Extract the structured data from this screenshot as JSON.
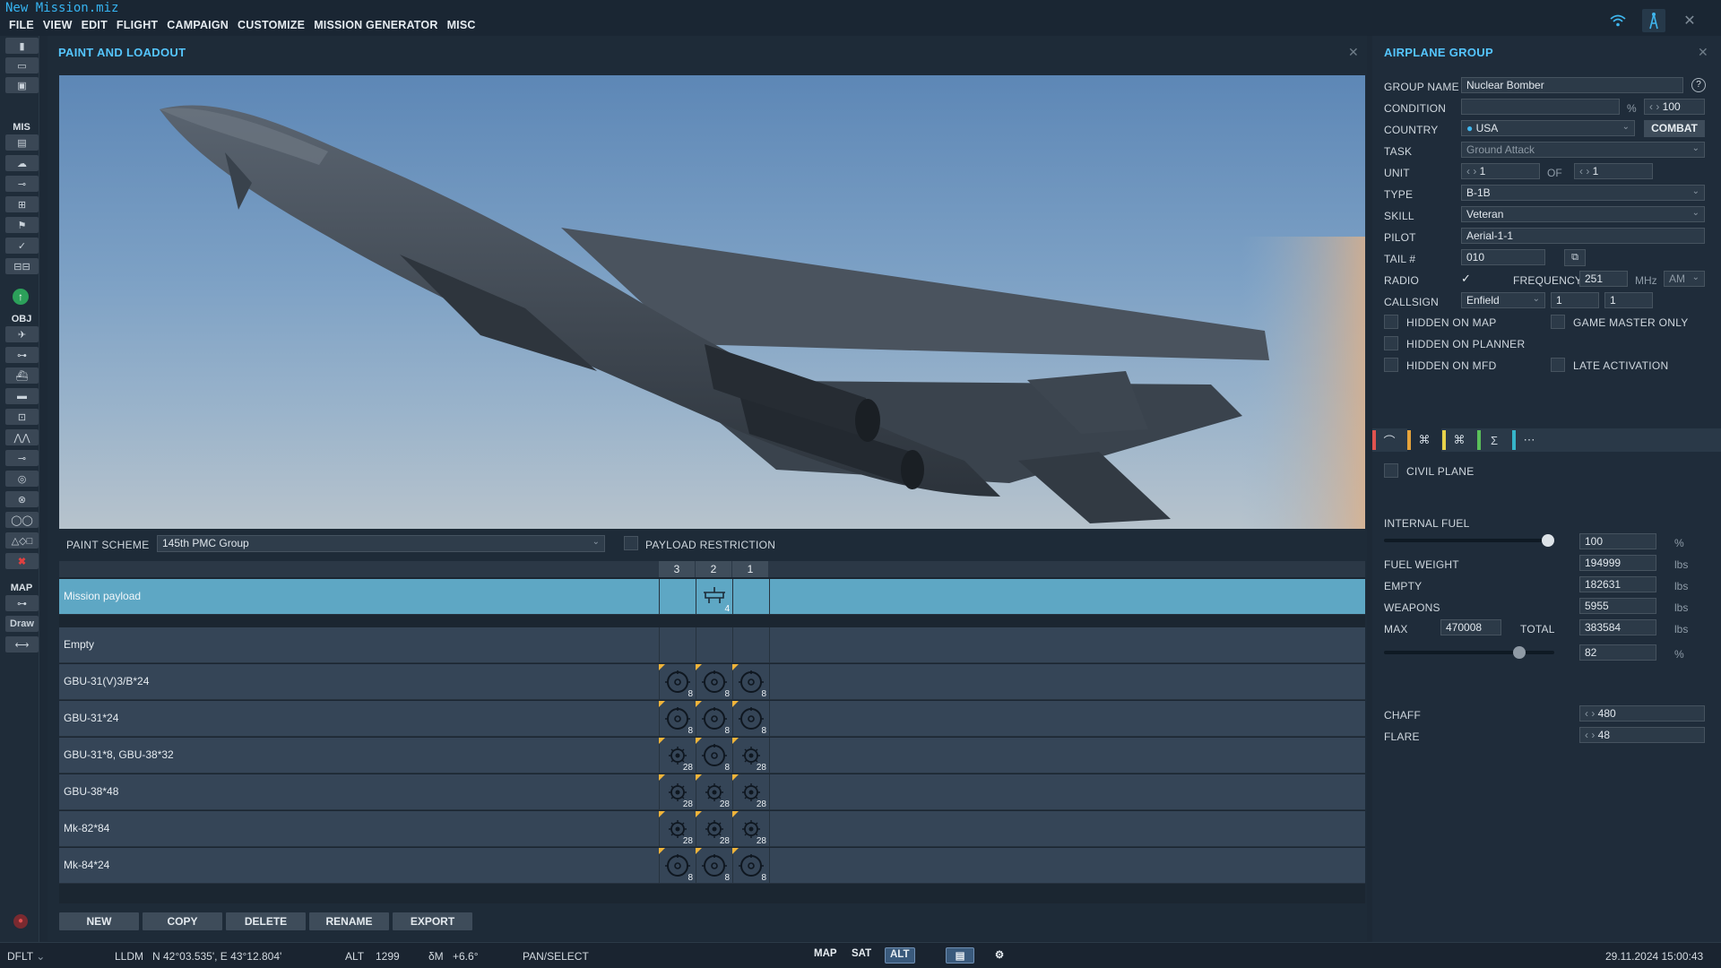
{
  "window": {
    "title": "New Mission.miz"
  },
  "menu": [
    "FILE",
    "VIEW",
    "EDIT",
    "FLIGHT",
    "CAMPAIGN",
    "CUSTOMIZE",
    "MISSION GENERATOR",
    "MISC"
  ],
  "toolbar": {
    "sections": {
      "mis": "MIS",
      "obj": "OBJ",
      "map": "MAP"
    },
    "draw_label": "Draw",
    "icons": [
      "new-icon",
      "open-icon",
      "save-icon",
      "briefing-icon",
      "weather-icon",
      "trigger-icon",
      "zone-icon",
      "flag-icon",
      "check-icon",
      "rules-icon",
      "helper-icon",
      "airplane-icon",
      "helicopter-icon",
      "ship-icon",
      "vehicle-icon",
      "static-icon",
      "template-icon",
      "nav-point-icon",
      "target-icon",
      "jammer-icon",
      "group-icon",
      "shapes-icon",
      "delete-icon",
      "ruler-icon"
    ]
  },
  "paint_loadout": {
    "title": "PAINT AND LOADOUT",
    "paint_scheme_label": "PAINT SCHEME",
    "paint_scheme_value": "145th PMC Group",
    "payload_restriction_label": "PAYLOAD RESTRICTION",
    "pylon_headers": [
      "3",
      "2",
      "1"
    ],
    "mission_payload": {
      "name": "Mission payload",
      "pylon2_count": "4"
    },
    "loadouts": [
      {
        "name": "Empty",
        "pylons": []
      },
      {
        "name": "GBU-31(V)3/B*24",
        "pylons": [
          {
            "icon": "large-bomb-icon",
            "count": "8"
          },
          {
            "icon": "large-bomb-icon",
            "count": "8"
          },
          {
            "icon": "large-bomb-icon",
            "count": "8"
          }
        ]
      },
      {
        "name": "GBU-31*24",
        "pylons": [
          {
            "icon": "large-bomb-icon",
            "count": "8"
          },
          {
            "icon": "large-bomb-icon",
            "count": "8"
          },
          {
            "icon": "large-bomb-icon",
            "count": "8"
          }
        ]
      },
      {
        "name": "GBU-31*8, GBU-38*32",
        "pylons": [
          {
            "icon": "small-bomb-icon",
            "count": "28"
          },
          {
            "icon": "large-bomb-icon",
            "count": "8"
          },
          {
            "icon": "small-bomb-icon",
            "count": "28"
          }
        ]
      },
      {
        "name": "GBU-38*48",
        "pylons": [
          {
            "icon": "small-bomb-icon",
            "count": "28"
          },
          {
            "icon": "small-bomb-icon",
            "count": "28"
          },
          {
            "icon": "small-bomb-icon",
            "count": "28"
          }
        ]
      },
      {
        "name": "Mk-82*84",
        "pylons": [
          {
            "icon": "small-bomb-icon",
            "count": "28"
          },
          {
            "icon": "small-bomb-icon",
            "count": "28"
          },
          {
            "icon": "small-bomb-icon",
            "count": "28"
          }
        ]
      },
      {
        "name": "Mk-84*24",
        "pylons": [
          {
            "icon": "large-bomb-icon",
            "count": "8"
          },
          {
            "icon": "large-bomb-icon",
            "count": "8"
          },
          {
            "icon": "large-bomb-icon",
            "count": "8"
          }
        ]
      }
    ],
    "buttons": {
      "new": "NEW",
      "copy": "COPY",
      "delete": "DELETE",
      "rename": "RENAME",
      "export": "EXPORT"
    }
  },
  "airplane_group": {
    "title": "AIRPLANE GROUP",
    "group_name_label": "GROUP NAME",
    "group_name": "Nuclear Bomber",
    "condition_label": "CONDITION",
    "condition_unit": "%",
    "condition_value": "100",
    "country_label": "COUNTRY",
    "country": "USA",
    "combat_button": "COMBAT",
    "task_label": "TASK",
    "task": "Ground Attack",
    "unit_label": "UNIT",
    "unit_value": "1",
    "of_label": "OF",
    "unit_of_value": "1",
    "type_label": "TYPE",
    "type": "B-1B",
    "skill_label": "SKILL",
    "skill": "Veteran",
    "pilot_label": "PILOT",
    "pilot": "Aerial-1-1",
    "tail_label": "TAIL #",
    "tail": "010",
    "radio_label": "RADIO",
    "frequency_label": "FREQUENCY",
    "frequency": "251",
    "freq_unit": "MHz",
    "modulation": "AM",
    "callsign_label": "CALLSIGN",
    "callsign": "Enfield",
    "callsign_n1": "1",
    "callsign_n2": "1",
    "hidden_on_map": "HIDDEN ON MAP",
    "game_master_only": "GAME MASTER ONLY",
    "hidden_on_planner": "HIDDEN ON PLANNER",
    "hidden_on_mfd": "HIDDEN ON MFD",
    "late_activation": "LATE ACTIVATION",
    "tab_colors": [
      "#e0534f",
      "#e5a33b",
      "#e7d24a",
      "#5ac05a",
      "#36b5c9"
    ],
    "civil_plane": "CIVIL PLANE",
    "internal_fuel_label": "INTERNAL FUEL",
    "internal_fuel": "100",
    "internal_fuel_unit": "%",
    "internal_fuel_level": 1.0,
    "fuel_weight_label": "FUEL WEIGHT",
    "fuel_weight": "194999",
    "empty_label": "EMPTY",
    "empty": "182631",
    "weapons_label": "WEAPONS",
    "weapons": "5955",
    "max_label": "MAX",
    "max": "470008",
    "total_label": "TOTAL",
    "total": "383584",
    "weight_unit": "lbs",
    "total_percent": "82",
    "total_percent_unit": "%",
    "total_level": 0.82,
    "chaff_label": "CHAFF",
    "chaff": "480",
    "flare_label": "FLARE",
    "flare": "48"
  },
  "statusbar": {
    "mode": "DFLT",
    "coord_label": "LLDM",
    "coords": "N 42°03.535', E 43°12.804'",
    "alt_label": "ALT",
    "alt": "1299",
    "mag_label": "δM",
    "mag": "+6.6°",
    "tool": "PAN/SELECT",
    "map_btn": "MAP",
    "sat_btn": "SAT",
    "alt_btn": "ALT",
    "datetime": "29.11.2024 15:00:43"
  }
}
